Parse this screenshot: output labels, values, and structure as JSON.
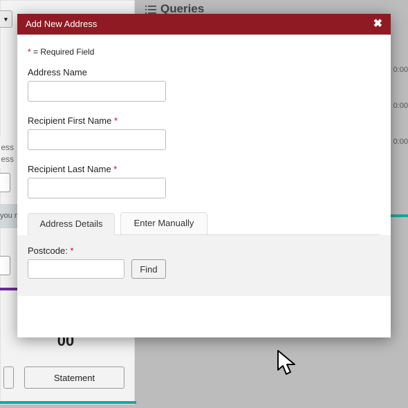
{
  "modal": {
    "title": "Add New Address",
    "required_note_prefix": "*",
    "required_note_rest": " = Required Field",
    "fields": {
      "address_name": {
        "label": "Address Name",
        "value": ""
      },
      "first_name": {
        "label": "Recipient First Name ",
        "required": "*",
        "value": ""
      },
      "last_name": {
        "label": "Recipient Last Name ",
        "required": "*",
        "value": ""
      }
    },
    "tabs": {
      "details": "Address Details",
      "manual": "Enter Manually"
    },
    "postcode": {
      "label": "Postcode: ",
      "required": "*",
      "value": "",
      "find": "Find"
    }
  },
  "background": {
    "queries_label": "Queries",
    "side_text_1": "ess",
    "side_text_2": "ess",
    "grey_row": "you m",
    "price": "00",
    "statement_btn": "Statement",
    "times": [
      "0:00",
      "0:00",
      "0:00"
    ]
  }
}
